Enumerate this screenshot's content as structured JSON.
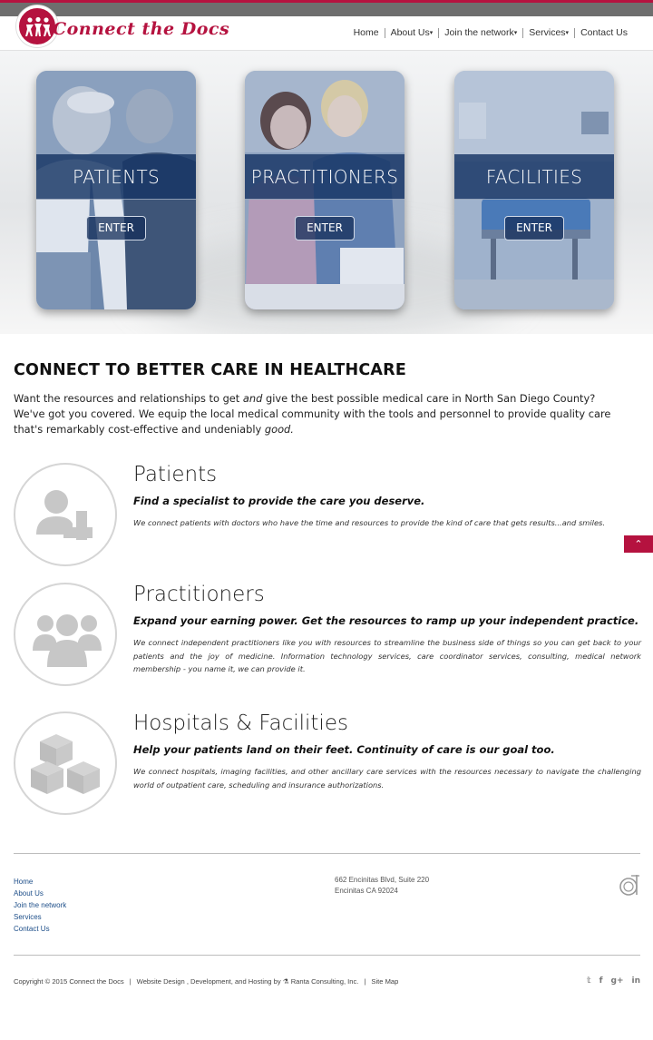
{
  "brand": {
    "name": "Connect the Docs",
    "accent": "#b5123f",
    "navy": "#163464"
  },
  "nav": {
    "items": [
      {
        "label": "Home",
        "dropdown": false
      },
      {
        "label": "About Us",
        "dropdown": true
      },
      {
        "label": "Join the network",
        "dropdown": true
      },
      {
        "label": "Services",
        "dropdown": true
      },
      {
        "label": "Contact Us",
        "dropdown": false
      }
    ]
  },
  "hero": {
    "cards": [
      {
        "title": "PATIENTS",
        "button": "ENTER"
      },
      {
        "title": "PRACTITIONERS",
        "button": "ENTER"
      },
      {
        "title": "FACILITIES",
        "button": "ENTER"
      }
    ]
  },
  "main": {
    "heading": "CONNECT TO BETTER CARE IN HEALTHCARE",
    "intro_line1_a": "Want the resources and relationships to get ",
    "intro_line1_em": "and",
    "intro_line1_b": " give the best possible medical care in North San Diego County?",
    "intro_line2_a": "We've got you covered. We equip the local medical community with the tools and personnel to provide quality care that's remarkably cost-effective and undeniably ",
    "intro_line2_em": "good.",
    "features": [
      {
        "icon": "patient-plus-icon",
        "title": "Patients",
        "subtitle": "Find a specialist to provide the care you deserve.",
        "description": "We connect patients with doctors who have the time and resources to provide the kind of care that gets results...and smiles."
      },
      {
        "icon": "group-icon",
        "title": "Practitioners",
        "subtitle": "Expand your earning power. Get the resources to ramp up your independent practice.",
        "description": "We connect independent practitioners like you with resources to streamline the business side of things so you can get back to your patients and the joy of medicine. Information technology services, care coordinator services, consulting, medical network membership - you name it, we can provide it."
      },
      {
        "icon": "boxes-icon",
        "title": "Hospitals & Facilities",
        "subtitle": "Help your patients land on their feet. Continuity of care is our goal too.",
        "description": "We connect hospitals, imaging facilities, and other ancillary care services with the resources necessary to navigate the challenging world of outpatient care, scheduling and insurance authorizations."
      }
    ]
  },
  "back_to_top": {
    "icon": "chevron-up-icon"
  },
  "footer": {
    "links": [
      "Home",
      "About Us",
      "Join the network",
      "Services",
      "Contact Us"
    ],
    "address_line1": "662 Encinitas Blvd, Suite 220",
    "address_line2": "Encinitas CA 92024",
    "copyright": "Copyright © 2015 Connect the Docs",
    "credit": "Website Design , Development, and Hosting by ⚗ Ranta Consulting, Inc.",
    "sitemap": "Site Map",
    "social": [
      {
        "icon": "twitter-icon",
        "glyph": "𝕥"
      },
      {
        "icon": "facebook-icon",
        "glyph": "f"
      },
      {
        "icon": "google-plus-icon",
        "glyph": "g+"
      },
      {
        "icon": "linkedin-icon",
        "glyph": "in"
      }
    ]
  }
}
